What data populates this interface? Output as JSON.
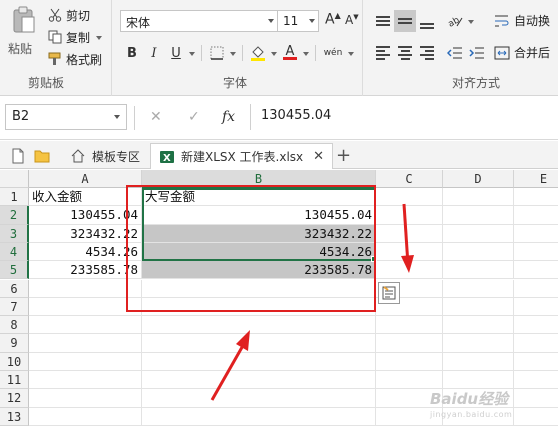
{
  "ribbon": {
    "clipboard": {
      "paste_label": "粘贴",
      "cut_label": "剪切",
      "copy_label": "复制",
      "format_painter_label": "格式刷",
      "group_label": "剪贴板"
    },
    "font": {
      "font_name": "宋体",
      "font_size": "11",
      "bold": "B",
      "italic": "I",
      "underline": "U",
      "font_color_glyph": "A",
      "phonetic_glyph": "wén",
      "group_label": "字体"
    },
    "alignment": {
      "wrap_text_label": "自动换",
      "merge_label": "合并后",
      "group_label": "对齐方式"
    }
  },
  "formula_bar": {
    "name_box": "B2",
    "cancel_glyph": "✕",
    "enter_glyph": "✓",
    "fx_label": "fx",
    "value": "130455.04"
  },
  "tabs": {
    "templates_label": "模板专区",
    "workbook_label": "新建XLSX 工作表.xlsx",
    "close_glyph": "✕",
    "new_tab_glyph": "+"
  },
  "sheet": {
    "columns": [
      "A",
      "B",
      "C",
      "D",
      "E"
    ],
    "rows": [
      "1",
      "2",
      "3",
      "4",
      "5",
      "6",
      "7",
      "8",
      "9",
      "10",
      "11",
      "12",
      "13"
    ],
    "cells": {
      "A1": "收入金额",
      "A2": "130455.04",
      "A3": "323432.22",
      "A4": "4534.26",
      "A5": "233585.78",
      "B1": "大写金额",
      "B2": "130455.04",
      "B3": "323432.22",
      "B4": "4534.26",
      "B5": "233585.78"
    },
    "selection": "B2:B5"
  },
  "watermark": {
    "text": "Baidu经验",
    "sub": "jingyan.baidu.com"
  },
  "colors": {
    "excel_green": "#217346",
    "annotation_red": "#e02020",
    "selection_fill": "#c6c6c6"
  }
}
